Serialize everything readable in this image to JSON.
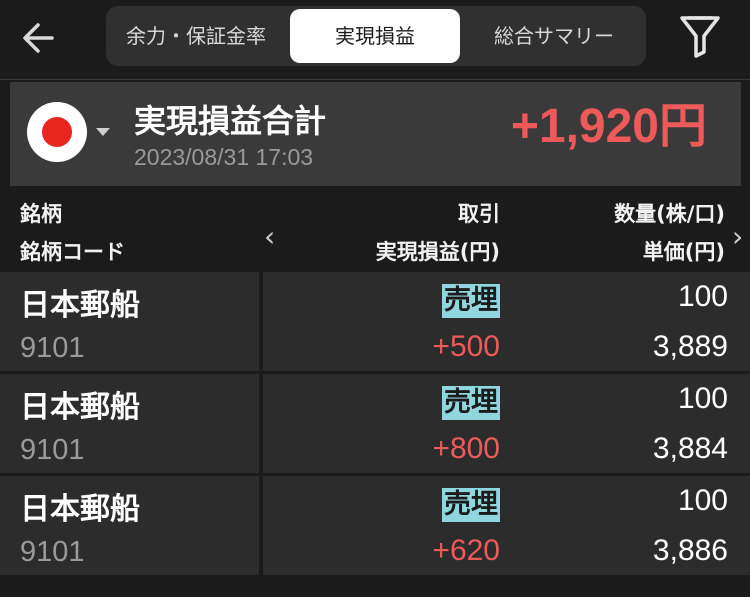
{
  "header": {
    "back_icon": "arrow-left-icon",
    "tabs": [
      "余力・保証金率",
      "実現損益",
      "総合サマリー"
    ],
    "active_tab": "実現損益",
    "filter_icon": "filter-icon"
  },
  "summary": {
    "flag_icon": "japan-flag-icon",
    "title": "実現損益合計",
    "timestamp": "2023/08/31 17:03",
    "total": "+1,920円"
  },
  "columns": {
    "col1_line1": "銘柄",
    "col1_line2": "銘柄コード",
    "col2_line1": "取引",
    "col2_line2": "実現損益(円)",
    "col3_line1": "数量(株/口)",
    "col3_line2": "単価(円)"
  },
  "rows": [
    {
      "name": "日本郵船",
      "code": "9101",
      "trade": "売埋",
      "pnl": "+500",
      "quantity": "100",
      "price": "3,889"
    },
    {
      "name": "日本郵船",
      "code": "9101",
      "trade": "売埋",
      "pnl": "+800",
      "quantity": "100",
      "price": "3,884"
    },
    {
      "name": "日本郵船",
      "code": "9101",
      "trade": "売埋",
      "pnl": "+620",
      "quantity": "100",
      "price": "3,886"
    }
  ],
  "colors": {
    "background": "#1b1b1b",
    "row": "#2c2c2c",
    "profit": "#ee5a5a",
    "trade_badge": "#8fd6de"
  }
}
